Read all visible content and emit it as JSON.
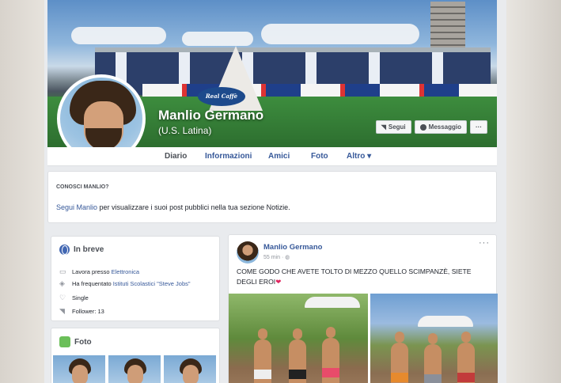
{
  "profile": {
    "name": "Manlio Germano",
    "subtitle": "(U.S. Latina)"
  },
  "cover_branding": {
    "sponsor_text": "Real Caffè"
  },
  "actions": {
    "follow_label": "Segui",
    "message_label": "Messaggio",
    "more_label": "···"
  },
  "tabs": [
    {
      "label": "Diario"
    },
    {
      "label": "Informazioni"
    },
    {
      "label": "Amici"
    },
    {
      "label": "Foto"
    },
    {
      "label": "Altro ▾"
    }
  ],
  "know": {
    "title": "CONOSCI MANLIO?",
    "link": "Segui Manlio",
    "text": " per visualizzare i suoi post pubblici nella tua sezione Notizie."
  },
  "brief": {
    "title": "In breve",
    "work_prefix": "Lavora presso ",
    "work_place": "Elettronica",
    "study_prefix": "Ha frequentato ",
    "study_place": "Istituti Scolastici \"Steve Jobs\"",
    "relationship": "Single",
    "followers": "Follower: 13"
  },
  "photos_section": {
    "title": "Foto"
  },
  "post": {
    "author": "Manlio Germano",
    "time": "55 min · ",
    "text": "COME GODO CHE AVETE TOLTO DI MEZZO QUELLO SCIMPANZÈ, SIETE DEGLI EROI",
    "more": "···"
  },
  "colors": {
    "fb_link": "#365899",
    "fb_bg": "#e9ebee",
    "heart": "#e0245e"
  },
  "icons": {
    "follow": "rss-icon",
    "message": "messenger-icon",
    "brief": "globe-icon",
    "photos": "photo-icon"
  }
}
